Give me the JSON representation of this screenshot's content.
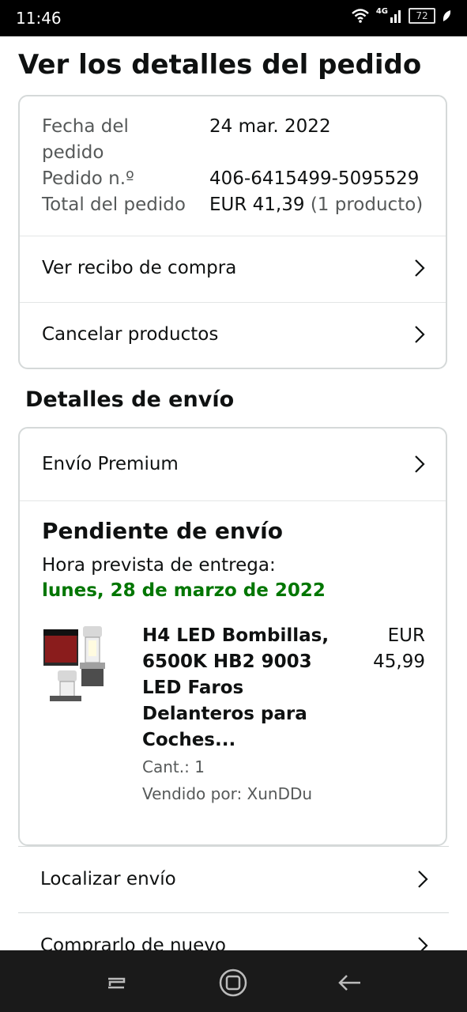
{
  "status_bar": {
    "time": "11:46",
    "network": "4G",
    "battery": "72"
  },
  "page_title": "Ver los detalles del pedido",
  "order": {
    "date_label": "Fecha del pedido",
    "date_value": "24 mar. 2022",
    "number_label": "Pedido n.º",
    "number_value": "406-6415499-5095529",
    "total_label": "Total del pedido",
    "total_value": "EUR 41,39",
    "total_count": "(1 producto)"
  },
  "order_links": {
    "receipt": "Ver recibo de compra",
    "cancel": "Cancelar productos"
  },
  "shipping": {
    "section_title": "Detalles de envío",
    "premium": "Envío Premium",
    "status": "Pendiente de envío",
    "eta_label": "Hora prevista de entrega:",
    "eta_date": "lunes, 28 de marzo de 2022"
  },
  "product": {
    "title_lines": [
      "H4 LED Bombillas,",
      "6500K HB2 9003",
      "LED Faros",
      "Delanteros para",
      "Coches..."
    ],
    "price_currency": "EUR",
    "price_amount": "45,99",
    "qty": "Cant.: 1",
    "seller": "Vendido por: XunDDu",
    "image": "led-bulb-product-icon"
  },
  "actions": {
    "track": "Localizar envío",
    "buy_again": "Comprarlo de nuevo"
  },
  "colors": {
    "green": "#007600",
    "border": "#d5d9d9"
  }
}
